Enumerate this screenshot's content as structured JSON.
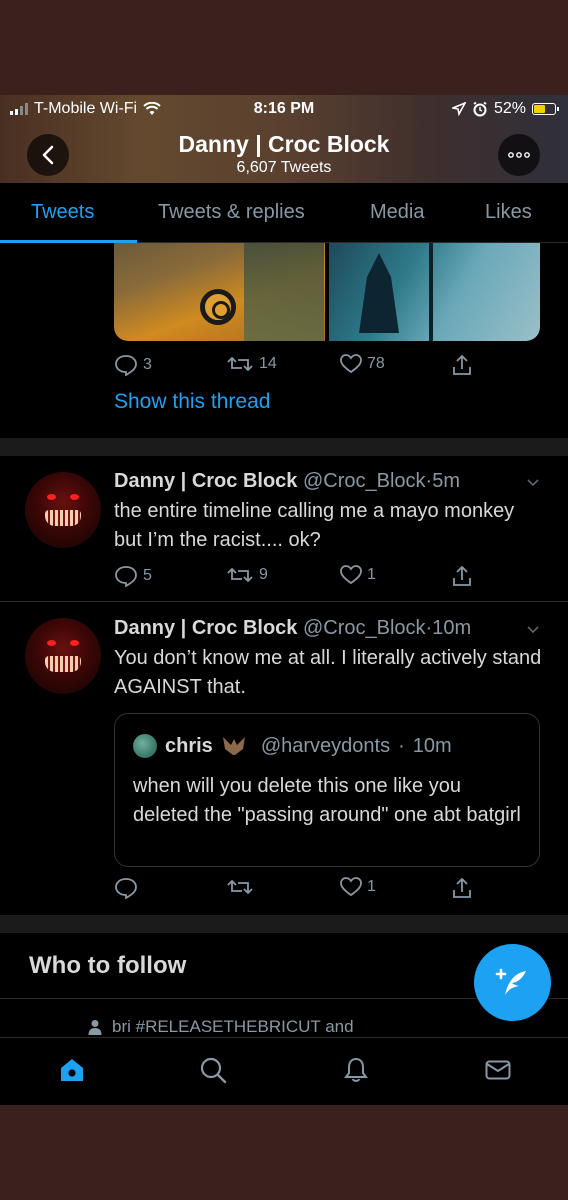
{
  "status_bar": {
    "carrier": "T-Mobile Wi-Fi",
    "time": "8:16 PM",
    "battery": "52%"
  },
  "header": {
    "name": "Danny | Croc Block",
    "tweet_count": "6,607 Tweets"
  },
  "tabs": [
    {
      "label": "Tweets",
      "active": true
    },
    {
      "label": "Tweets & replies",
      "active": false
    },
    {
      "label": "Media",
      "active": false
    },
    {
      "label": "Likes",
      "active": false
    }
  ],
  "tweets": [
    {
      "replies": "3",
      "retweets": "14",
      "likes": "78",
      "show_thread": "Show this thread"
    },
    {
      "name": "Danny | Croc Block",
      "handle": "@Croc_Block",
      "time": "5m",
      "text": "the entire timeline calling me a mayo monkey but I’m the racist.... ok?",
      "replies": "5",
      "retweets": "9",
      "likes": "1"
    },
    {
      "name": "Danny | Croc Block",
      "handle": "@Croc_Block",
      "time": "10m",
      "text": "You don’t know me at all. I literally actively stand AGAINST that.",
      "replies": "",
      "retweets": "",
      "likes": "1",
      "quote": {
        "name": "chris",
        "handle": "@harveydonts",
        "time": "10m",
        "text": "when will you delete this one like you deleted the \"passing around\" one abt batgirl"
      }
    }
  ],
  "who_to_follow": {
    "title": "Who to follow",
    "context": "bri #RELEASETHEBRICUT and"
  },
  "colors": {
    "accent": "#1da1f2",
    "background": "#000000",
    "muted": "#8899a6"
  }
}
